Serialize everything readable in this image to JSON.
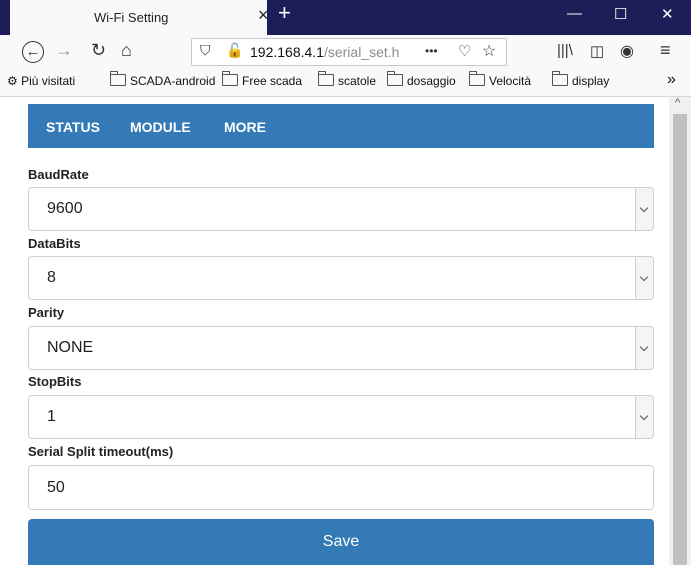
{
  "browser": {
    "tab_title": "Wi-Fi Setting",
    "tab_close": "×",
    "new_tab": "+",
    "win_minimize": "—",
    "win_maximize": "☐",
    "win_close": "✕",
    "url_host": "192.168.4.1",
    "url_path": "/serial_set.h",
    "more_dots": "•••",
    "bookmarks": [
      "Più visitati",
      "SCADA-android",
      "Free scada",
      "scatole",
      "dosaggio",
      "Velocità",
      "display"
    ],
    "bookmarks_overflow": "»",
    "icons": {
      "back": "back-arrow-icon",
      "forward": "forward-arrow-icon",
      "reload": "reload-icon",
      "home": "home-icon",
      "shield": "shield-icon",
      "insecure": "insecure-lock-icon",
      "pocket": "pocket-icon",
      "star": "star-icon",
      "library": "library-icon",
      "sidebar": "sidebar-icon",
      "account": "account-icon",
      "menu": "hamburger-menu-icon",
      "gear": "gear-icon",
      "folder": "folder-icon"
    }
  },
  "page": {
    "nav": [
      "STATUS",
      "MODULE",
      "MORE"
    ],
    "fields": [
      {
        "label": "BaudRate",
        "value": "9600"
      },
      {
        "label": "DataBits",
        "value": "8"
      },
      {
        "label": "Parity",
        "value": "NONE"
      },
      {
        "label": "StopBits",
        "value": "1"
      }
    ],
    "timeout_label": "Serial Split timeout(ms)",
    "timeout_value": "50",
    "save_label": "Save",
    "colors": {
      "primary": "#337ab7",
      "titlebar": "#1d1d58"
    }
  }
}
